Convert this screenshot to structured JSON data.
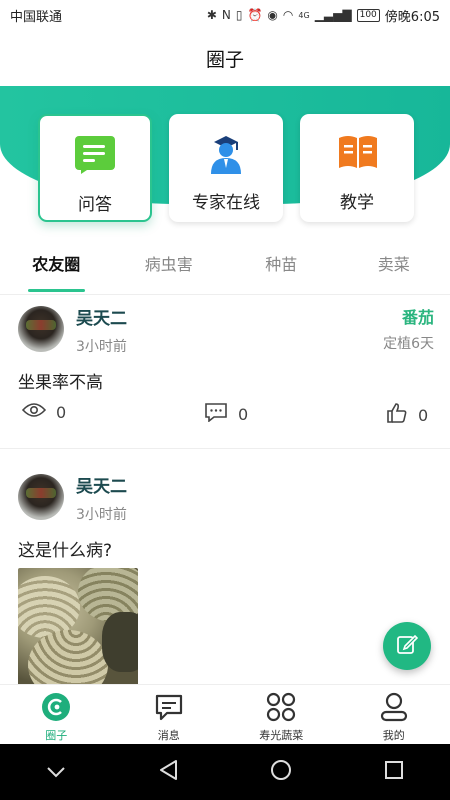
{
  "status_bar": {
    "carrier": "中国联通",
    "network": "4G",
    "battery": "100",
    "time": "傍晚6:05"
  },
  "header": {
    "title": "圈子"
  },
  "cards": [
    {
      "label": "问答",
      "icon": "qa-icon"
    },
    {
      "label": "专家在线",
      "icon": "expert-icon"
    },
    {
      "label": "教学",
      "icon": "book-icon"
    }
  ],
  "tabs": [
    {
      "label": "农友圈",
      "active": true
    },
    {
      "label": "病虫害",
      "active": false
    },
    {
      "label": "种苗",
      "active": false
    },
    {
      "label": "卖菜",
      "active": false
    }
  ],
  "posts": [
    {
      "user": "吴天二",
      "time": "3小时前",
      "crop": "番茄",
      "stage": "定植6天",
      "text": "坐果率不高",
      "views": "0",
      "comments": "0",
      "likes": "0"
    },
    {
      "user": "吴天二",
      "time": "3小时前",
      "text": "这是什么病?"
    }
  ],
  "bottom_nav": [
    {
      "label": "圈子",
      "icon": "circle-icon",
      "active": true
    },
    {
      "label": "消息",
      "icon": "message-icon",
      "active": false
    },
    {
      "label": "寿光蔬菜",
      "icon": "grid-icon",
      "active": false
    },
    {
      "label": "我的",
      "icon": "profile-icon",
      "active": false
    }
  ],
  "colors": {
    "accent": "#2bc48f",
    "banner": "#1cbd9c",
    "crop_tag": "#2bb57f",
    "username": "#1c4a4f"
  }
}
